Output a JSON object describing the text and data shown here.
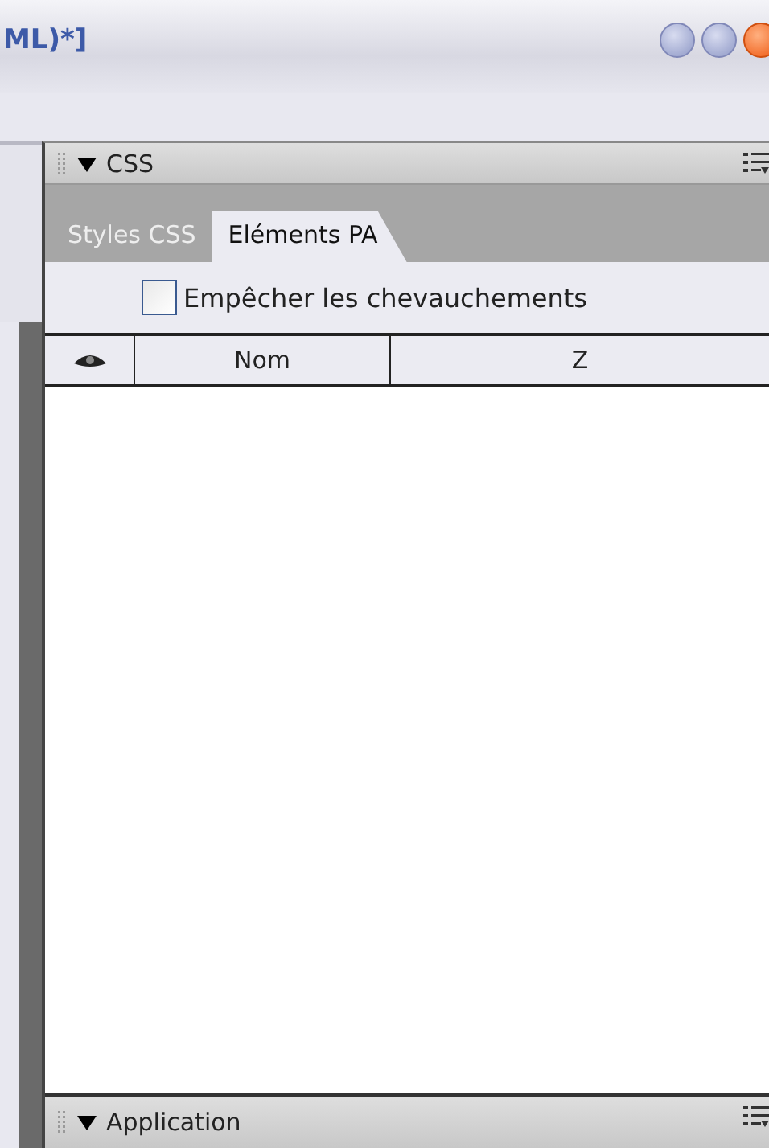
{
  "window": {
    "title": "ML)*]"
  },
  "panel": {
    "title": "CSS",
    "expanded": true
  },
  "tabs": [
    {
      "label": "Styles CSS",
      "selected": false
    },
    {
      "label": "Eléments PA",
      "selected": true
    }
  ],
  "prevent_overlaps": {
    "label": "Empêcher les chevauchements",
    "checked": false
  },
  "table": {
    "columns": [
      "Nom",
      "Z"
    ]
  },
  "bottom_panel": {
    "title": "Application",
    "expanded": true
  }
}
